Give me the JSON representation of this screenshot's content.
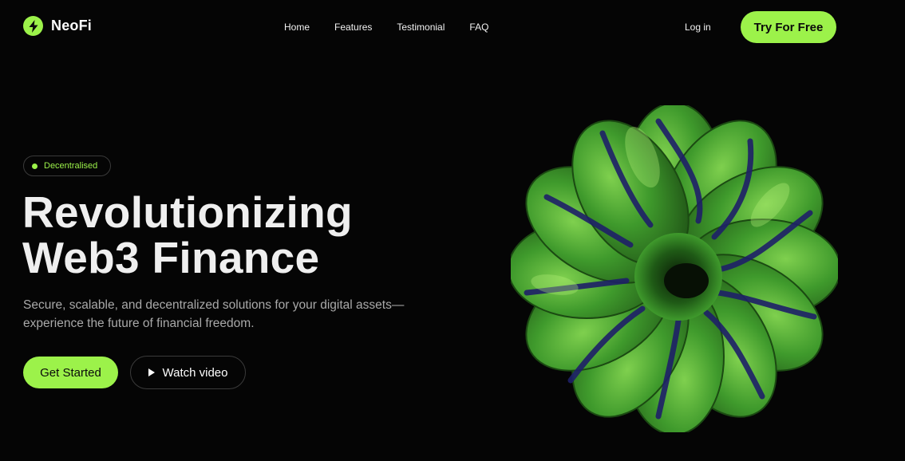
{
  "brand": {
    "name": "NeoFi",
    "logo_icon": "lightning-bolt-icon",
    "accent_color": "#9cf24a"
  },
  "nav": {
    "items": [
      {
        "label": "Home"
      },
      {
        "label": "Features"
      },
      {
        "label": "Testimonial"
      },
      {
        "label": "FAQ"
      }
    ],
    "login_label": "Log in",
    "cta_label": "Try For Free"
  },
  "hero": {
    "badge": "Decentralised",
    "headline_line1": "Revolutionizing",
    "headline_line2": "Web3 Finance",
    "subtitle": "Secure, scalable, and decentralized solutions for your digital assets—experience the future of financial freedom.",
    "primary_cta": "Get Started",
    "secondary_cta": "Watch video",
    "secondary_icon": "play-icon"
  }
}
